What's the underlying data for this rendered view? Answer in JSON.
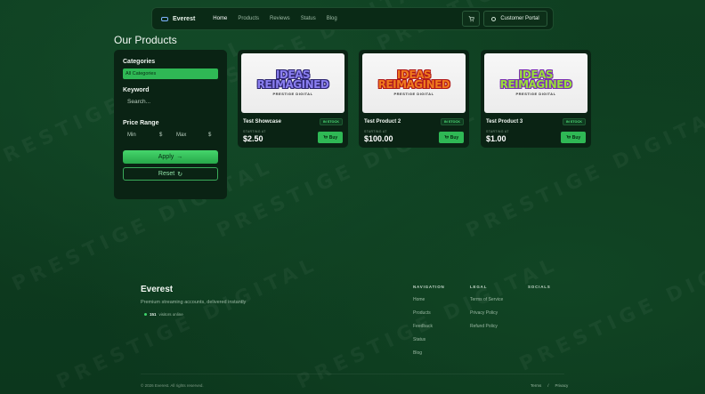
{
  "watermark_text": "PRESTIGE DIGITAL",
  "nav": {
    "brand": "Everest",
    "links": [
      "Home",
      "Products",
      "Reviews",
      "Status",
      "Blog"
    ],
    "active": "Home",
    "cart_icon": "cart-icon",
    "portal_label": "Customer Portal"
  },
  "page_title": "Our Products",
  "filter": {
    "categories_label": "Categories",
    "categories_value": "All Categories",
    "keyword_label": "Keyword",
    "keyword_placeholder": "Search...",
    "price_label": "Price Range",
    "min_placeholder": "Min",
    "max_placeholder": "Max",
    "currency": "$",
    "apply_label": "Apply",
    "apply_icon": "→",
    "reset_label": "Reset",
    "reset_icon": "↻"
  },
  "products": [
    {
      "name": "Test Showcase",
      "stock": "IN STOCK",
      "starting_label": "STARTING AT",
      "price": "$2.50",
      "buy_label": "Buy",
      "art_line1": "IDEAS",
      "art_line2": "REIMAGINED",
      "art_sub": "PRESTIGE DIGITAL",
      "art_color": "#8a7ff0",
      "art_outline": "#2c2470"
    },
    {
      "name": "Test Product 2",
      "stock": "IN STOCK",
      "starting_label": "STARTING AT",
      "price": "$100.00",
      "buy_label": "Buy",
      "art_line1": "IDEAS",
      "art_line2": "REIMAGINED",
      "art_sub": "PRESTIGE DIGITAL",
      "art_color": "#f07a1e",
      "art_outline": "#b01818"
    },
    {
      "name": "Test Product 3",
      "stock": "IN STOCK",
      "starting_label": "STARTING AT",
      "price": "$1.00",
      "buy_label": "Buy",
      "art_line1": "IDEAS",
      "art_line2": "REIMAGINED",
      "art_sub": "PRESTIGE DIGITAL",
      "art_color": "#9adf3a",
      "art_outline": "#7a2fb0"
    }
  ],
  "footer": {
    "brand": "Everest",
    "tagline": "Premium streaming accounts, delivered instantly",
    "online_count": "151",
    "online_label": "visitors online",
    "nav_header": "NAVIGATION",
    "nav_links": [
      "Home",
      "Products",
      "Feedback",
      "Status",
      "Blog"
    ],
    "legal_header": "LEGAL",
    "legal_links": [
      "Terms of Service",
      "Privacy Policy",
      "Refund Policy"
    ],
    "socials_header": "SOCIALS",
    "copyright": "© 2026 Everest. All rights reserved.",
    "bottom_links": [
      "Terms",
      "Privacy"
    ],
    "bottom_sep": "/"
  }
}
